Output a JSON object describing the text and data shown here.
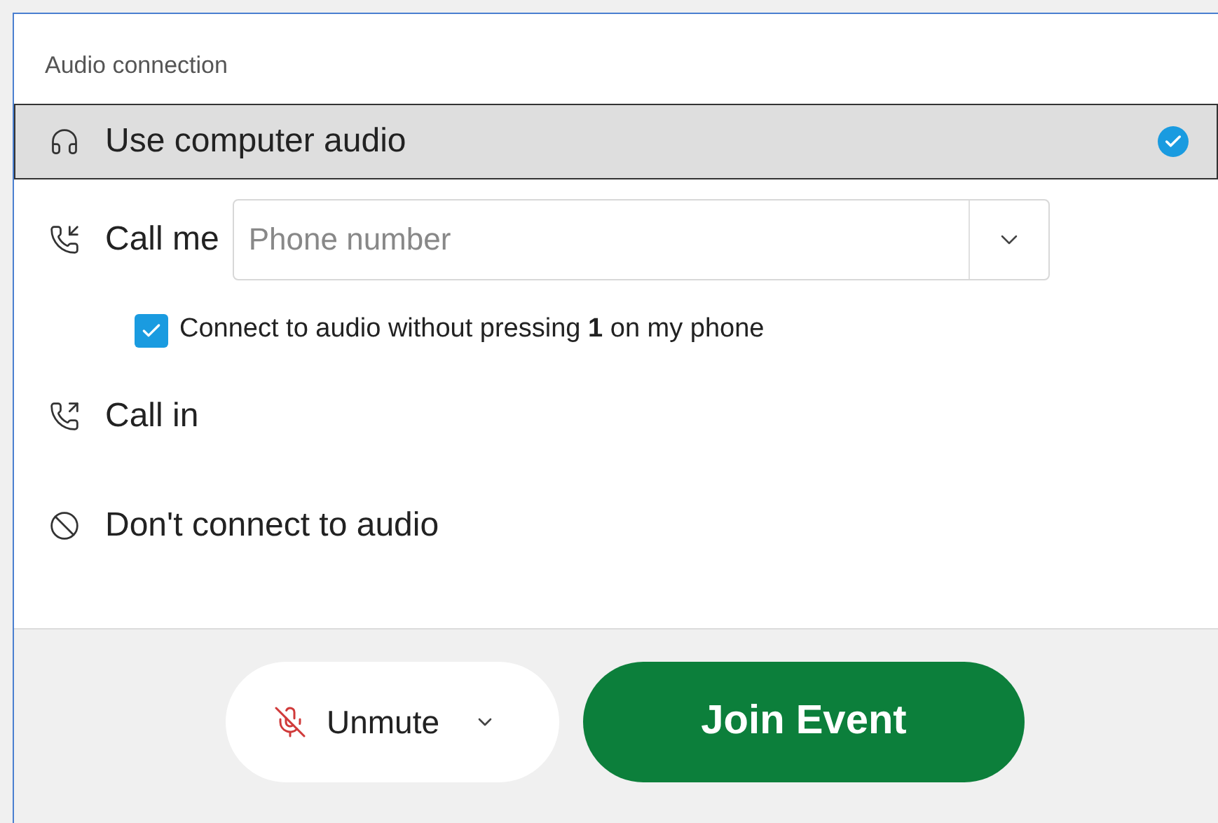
{
  "panel": {
    "title": "Audio connection"
  },
  "options": [
    {
      "kind": "computer",
      "label": "Use computer audio",
      "selected": true
    },
    {
      "kind": "call-me",
      "label": "Call me",
      "selected": false,
      "phone_field": {
        "placeholder": "Phone number"
      },
      "auto_connect": {
        "label": "Connect to audio without pressing **1** on my phone",
        "checked": true
      }
    },
    {
      "kind": "call-in",
      "label": "Call in",
      "selected": false
    },
    {
      "kind": "none",
      "label": "Don't connect to audio",
      "selected": false
    }
  ],
  "footer": {
    "mute_button": {
      "label": "Unmute",
      "muted": true
    },
    "join_button": {
      "label": "Join Event"
    }
  }
}
